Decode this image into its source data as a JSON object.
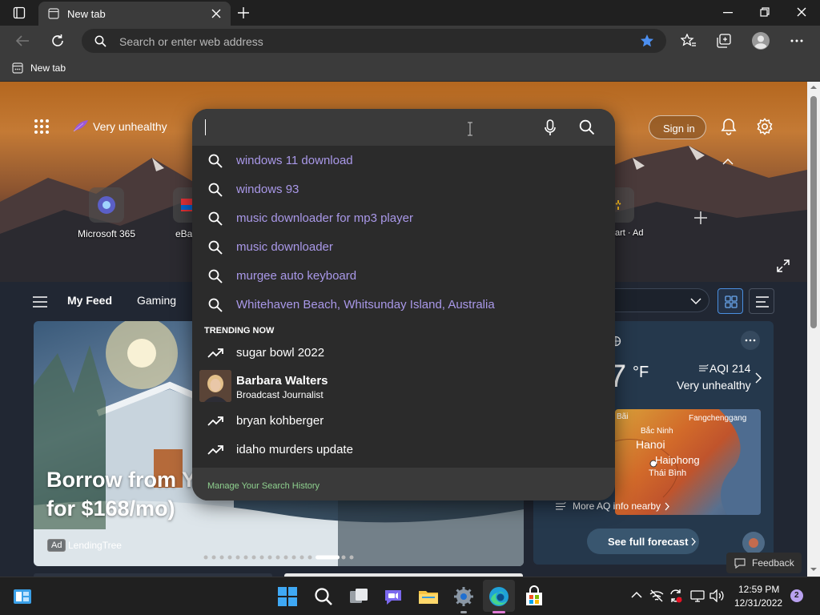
{
  "browser": {
    "tab_title": "New tab",
    "address_placeholder": "Search or enter web address",
    "favorites": [
      {
        "label": "New tab"
      }
    ]
  },
  "header": {
    "aq_status": "Very unhealthy",
    "sign_in": "Sign in"
  },
  "quick_links": [
    {
      "label": "Microsoft 365"
    },
    {
      "label": "eBay"
    },
    {
      "label": "art · Ad"
    }
  ],
  "feed": {
    "tabs": [
      {
        "label": "My Feed"
      },
      {
        "label": "Gaming"
      }
    ],
    "hero_card": {
      "title_line1": "Borrow from Y",
      "title_line2": "for $168/mo)",
      "ad_badge": "Ad",
      "sponsor": "LendingTree"
    }
  },
  "weather": {
    "temp": "7",
    "unit": "°F",
    "aqi": "AQI 214",
    "aq_label": "Very unhealthy",
    "map_labels": [
      "Bắc Ninh",
      "Hanoi",
      "Haiphong",
      "Thái Bình",
      "Fangchenggang",
      "Bãi"
    ],
    "more_aq": "More AQ info nearby",
    "forecast_button": "See full forecast",
    "feedback": "Feedback"
  },
  "search": {
    "suggestions": [
      {
        "text": "windows 11 download"
      },
      {
        "text": "windows 93"
      },
      {
        "text": "music downloader for mp3 player"
      },
      {
        "text": "music downloader"
      },
      {
        "text": "murgee auto keyboard"
      },
      {
        "text": "Whitehaven Beach, Whitsunday Island, Australia"
      }
    ],
    "trending_header": "TRENDING NOW",
    "trending": [
      {
        "text": "sugar bowl 2022"
      },
      {
        "text": "bryan kohberger"
      },
      {
        "text": "idaho murders update"
      }
    ],
    "person": {
      "name": "Barbara Walters",
      "subtitle": "Broadcast Journalist"
    },
    "manage_history": "Manage Your Search History"
  },
  "taskbar": {
    "time": "12:59 PM",
    "date": "12/31/2022",
    "notifications": "2"
  }
}
